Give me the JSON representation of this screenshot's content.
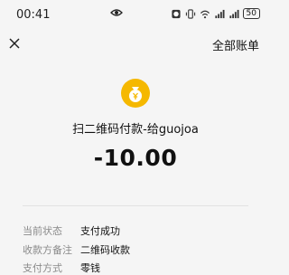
{
  "status_bar": {
    "time": "00:41",
    "battery": "50",
    "icons": [
      "eye-icon",
      "alarm-icon",
      "vibrate-icon",
      "wifi-icon",
      "signal-icon",
      "signal-icon",
      "battery-icon"
    ]
  },
  "nav": {
    "close_icon": "close-icon",
    "all_bills_label": "全部账单"
  },
  "transaction": {
    "logo_icon": "money-bag-icon",
    "logo_color": "#f5b800",
    "title": "扫二维码付款-给guojoa",
    "amount": "-10.00"
  },
  "details": [
    {
      "label": "当前状态",
      "value": "支付成功"
    },
    {
      "label": "收款方备注",
      "value": "二维码收款"
    },
    {
      "label": "支付方式",
      "value": "零钱"
    }
  ]
}
